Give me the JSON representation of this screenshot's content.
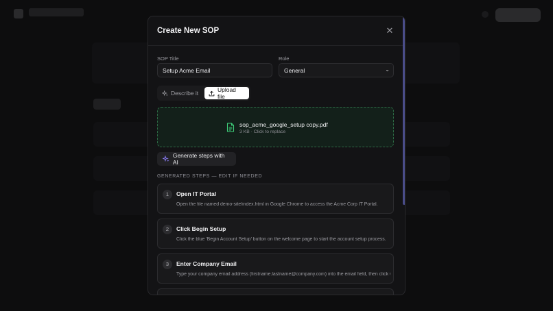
{
  "modal": {
    "title": "Create New SOP",
    "close_icon": "close-icon"
  },
  "form": {
    "title_label": "SOP Title",
    "title_value": "Setup Acme Email",
    "role_label": "Role",
    "role_value": "General"
  },
  "mode_toggle": {
    "describe_label": "Describe it",
    "upload_label": "Upload file",
    "active": "upload"
  },
  "upload": {
    "file_name": "sop_acme_google_setup copy.pdf",
    "file_meta": "3 KB · Click to replace"
  },
  "generate_button": {
    "label": "Generate steps with AI"
  },
  "steps_section": {
    "heading": "GENERATED STEPS — EDIT IF NEEDED",
    "steps": [
      {
        "number": "1",
        "title": "Open IT Portal",
        "description": "Open the file named demo-site/index.html in Google Chrome to access the Acme Corp IT Portal."
      },
      {
        "number": "2",
        "title": "Click Begin Setup",
        "description": "Click the blue 'Begin Account Setup' button on the welcome page to start the account setup process."
      },
      {
        "number": "3",
        "title": "Enter Company Email",
        "description": "Type your company email address (firstname.lastname@company.com) into the email field, then click Continue."
      },
      {
        "number": "4",
        "title": "",
        "description": ""
      }
    ]
  },
  "colors": {
    "accent_green": "#3ecf7a",
    "accent_purple": "#8b7cf6",
    "modal_bg": "#131315"
  }
}
